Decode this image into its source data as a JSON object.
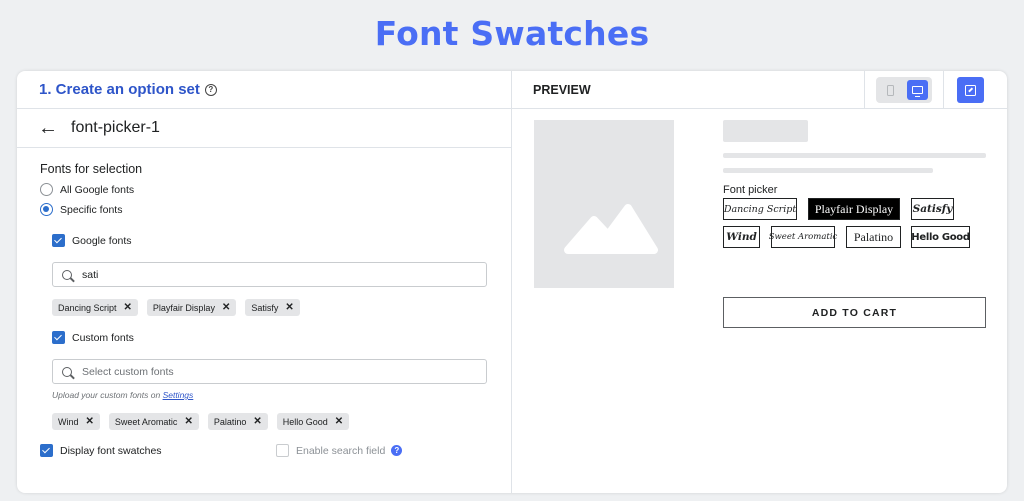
{
  "page": {
    "title": "Font Swatches"
  },
  "left": {
    "step_title": "1. Create an option set",
    "option_set_name": "font-picker-1",
    "fonts_label": "Fonts for selection",
    "radios": {
      "all": "All Google fonts",
      "specific": "Specific fonts"
    },
    "google": {
      "label": "Google fonts",
      "search_value": "sati",
      "tags": [
        "Dancing Script",
        "Playfair Display",
        "Satisfy"
      ]
    },
    "custom": {
      "label": "Custom fonts",
      "placeholder": "Select custom fonts",
      "hint_text": "Upload your custom fonts on ",
      "hint_link": "Settings",
      "tags": [
        "Wind",
        "Sweet Aromatic",
        "Palatino",
        "Hello Good"
      ]
    },
    "display_swatches_label": "Display font swatches",
    "enable_search_label": "Enable search field"
  },
  "right": {
    "preview_title": "PREVIEW",
    "picker_label": "Font picker",
    "swatches": [
      "Dancing Script",
      "Playfair Display",
      "Satisfy",
      "Wind",
      "Sweet Aromatic",
      "Palatino",
      "Hello Good"
    ],
    "selected_swatch": "Playfair Display",
    "add_to_cart": "ADD TO CART"
  },
  "colors": {
    "accent": "#4a6ef5",
    "link": "#2e55c9",
    "checkbox": "#2c6ecb"
  }
}
